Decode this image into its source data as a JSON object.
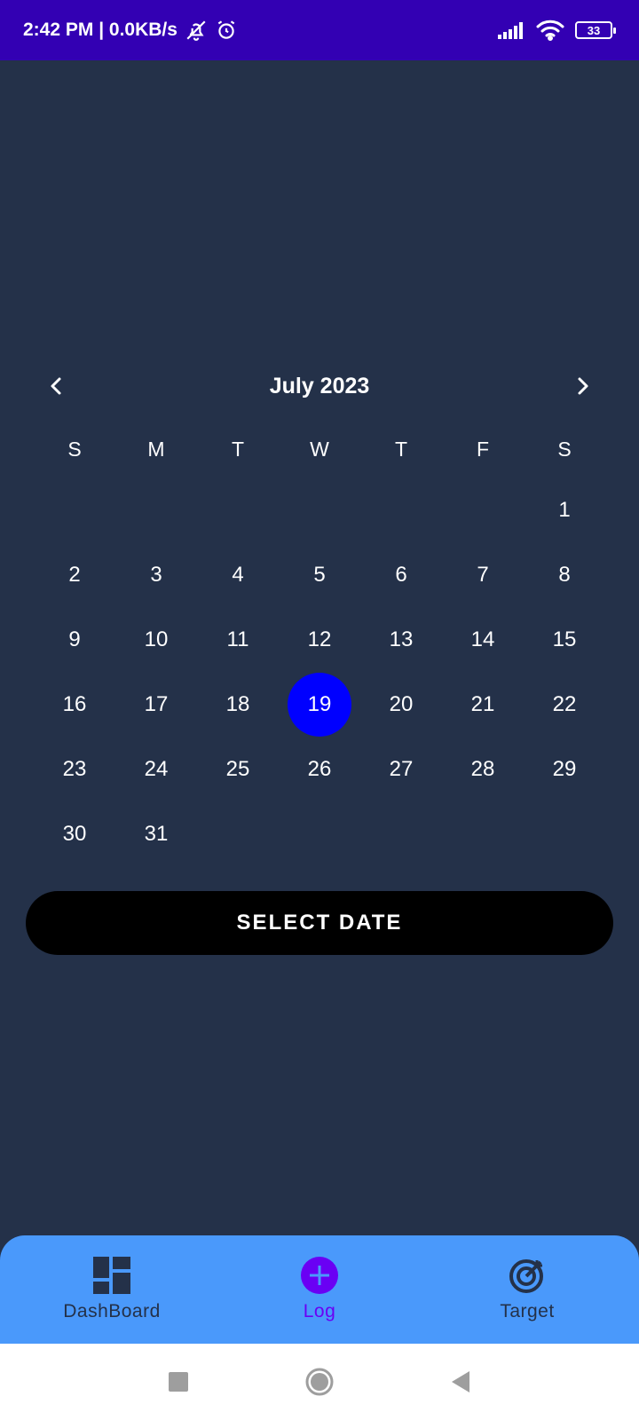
{
  "status_bar": {
    "time_network": "2:42 PM | 0.0KB/s",
    "battery_level": "33",
    "icons": [
      "notifications-off-icon",
      "alarm-icon",
      "signal-icon",
      "wifi-icon",
      "battery-icon"
    ]
  },
  "calendar": {
    "month_title": "July 2023",
    "prev_icon": "chevron-left-icon",
    "next_icon": "chevron-right-icon",
    "weekdays": [
      "S",
      "M",
      "T",
      "W",
      "T",
      "F",
      "S"
    ],
    "days": [
      "1",
      "2",
      "3",
      "4",
      "5",
      "6",
      "7",
      "8",
      "9",
      "10",
      "11",
      "12",
      "13",
      "14",
      "15",
      "16",
      "17",
      "18",
      "19",
      "20",
      "21",
      "22",
      "23",
      "24",
      "25",
      "26",
      "27",
      "28",
      "29",
      "30",
      "31"
    ],
    "selected_day": "19",
    "selected_color": "#0000ff"
  },
  "select_button": {
    "label": "SELECT DATE"
  },
  "bottom_nav": {
    "items": [
      {
        "label": "DashBoard",
        "icon": "dashboard-icon",
        "color": "#243149"
      },
      {
        "label": "Log",
        "icon": "add-circle-icon",
        "color": "#6a00f4"
      },
      {
        "label": "Target",
        "icon": "target-icon",
        "color": "#243149"
      }
    ]
  },
  "system_nav": {
    "icons": [
      "recents-square-icon",
      "home-circle-icon",
      "back-triangle-icon"
    ]
  },
  "colors": {
    "status_bar": "#3300b3",
    "background": "#243149",
    "bottom_nav": "#4a99fb",
    "button": "#000000"
  }
}
